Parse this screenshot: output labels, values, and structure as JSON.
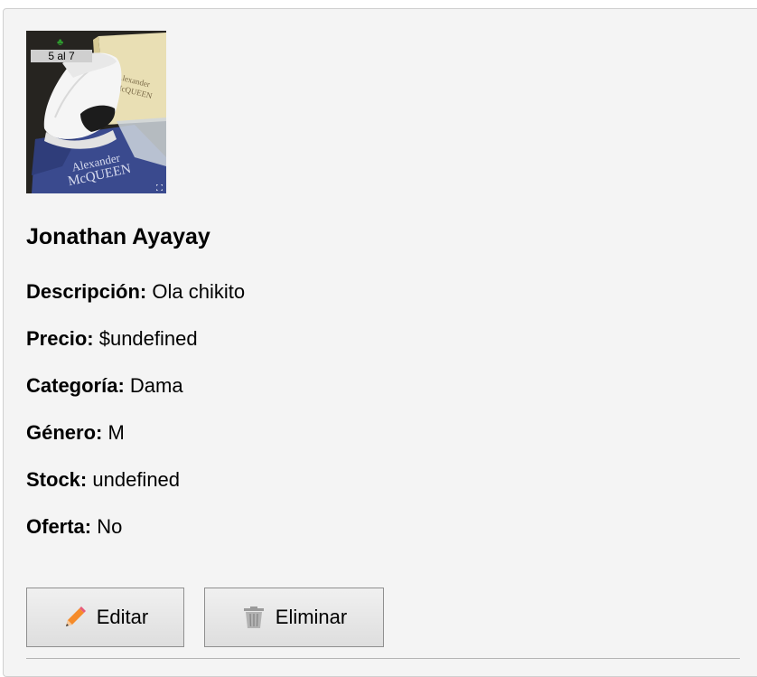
{
  "product": {
    "image_counter": "5 al 7",
    "image_alt": "Zapatilla blanca Alexander McQueen",
    "box_brand_line1": "Alexander",
    "box_brand_line2": "McQUEEN",
    "bag_brand_line1": "Alexander",
    "bag_brand_line2": "McQUEEN",
    "name": "Jonathan Ayayay",
    "fields": [
      {
        "label": "Descripción:",
        "value": "Ola chikito"
      },
      {
        "label": "Precio:",
        "value": "$undefined"
      },
      {
        "label": "Categoría:",
        "value": "Dama"
      },
      {
        "label": "Género:",
        "value": "M"
      },
      {
        "label": "Stock:",
        "value": "undefined"
      },
      {
        "label": "Oferta:",
        "value": "No"
      }
    ]
  },
  "actions": {
    "edit_label": "Editar",
    "edit_icon": "pencil-icon",
    "delete_label": "Eliminar",
    "delete_icon": "trash-icon"
  },
  "colors": {
    "card_background": "#f4f4f4",
    "button_border": "#8f8f8f",
    "pencil": "#f58b2a",
    "trash": "#9a9a9a"
  }
}
